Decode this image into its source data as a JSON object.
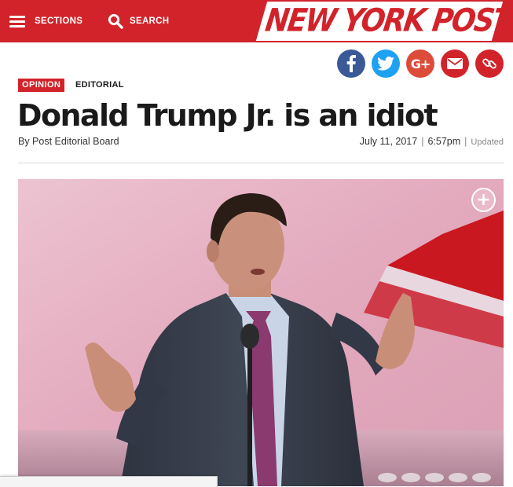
{
  "header": {
    "sections_label": "SECTIONS",
    "search_label": "SEARCH",
    "logo_text": "NEW YORK POST",
    "brand_color": "#d2232a"
  },
  "share": {
    "icons": [
      "facebook-icon",
      "twitter-icon",
      "google-plus-icon",
      "email-icon",
      "link-icon"
    ],
    "google_plus_label": "G+"
  },
  "article": {
    "category": "OPINION",
    "subcategory": "EDITORIAL",
    "headline": "Donald Trump Jr. is an idiot",
    "byline": "By Post Editorial Board",
    "date": "July 11, 2017",
    "time": "6:57pm",
    "updated_label": "Updated"
  },
  "photo": {
    "expand_icon": "plus-icon"
  }
}
